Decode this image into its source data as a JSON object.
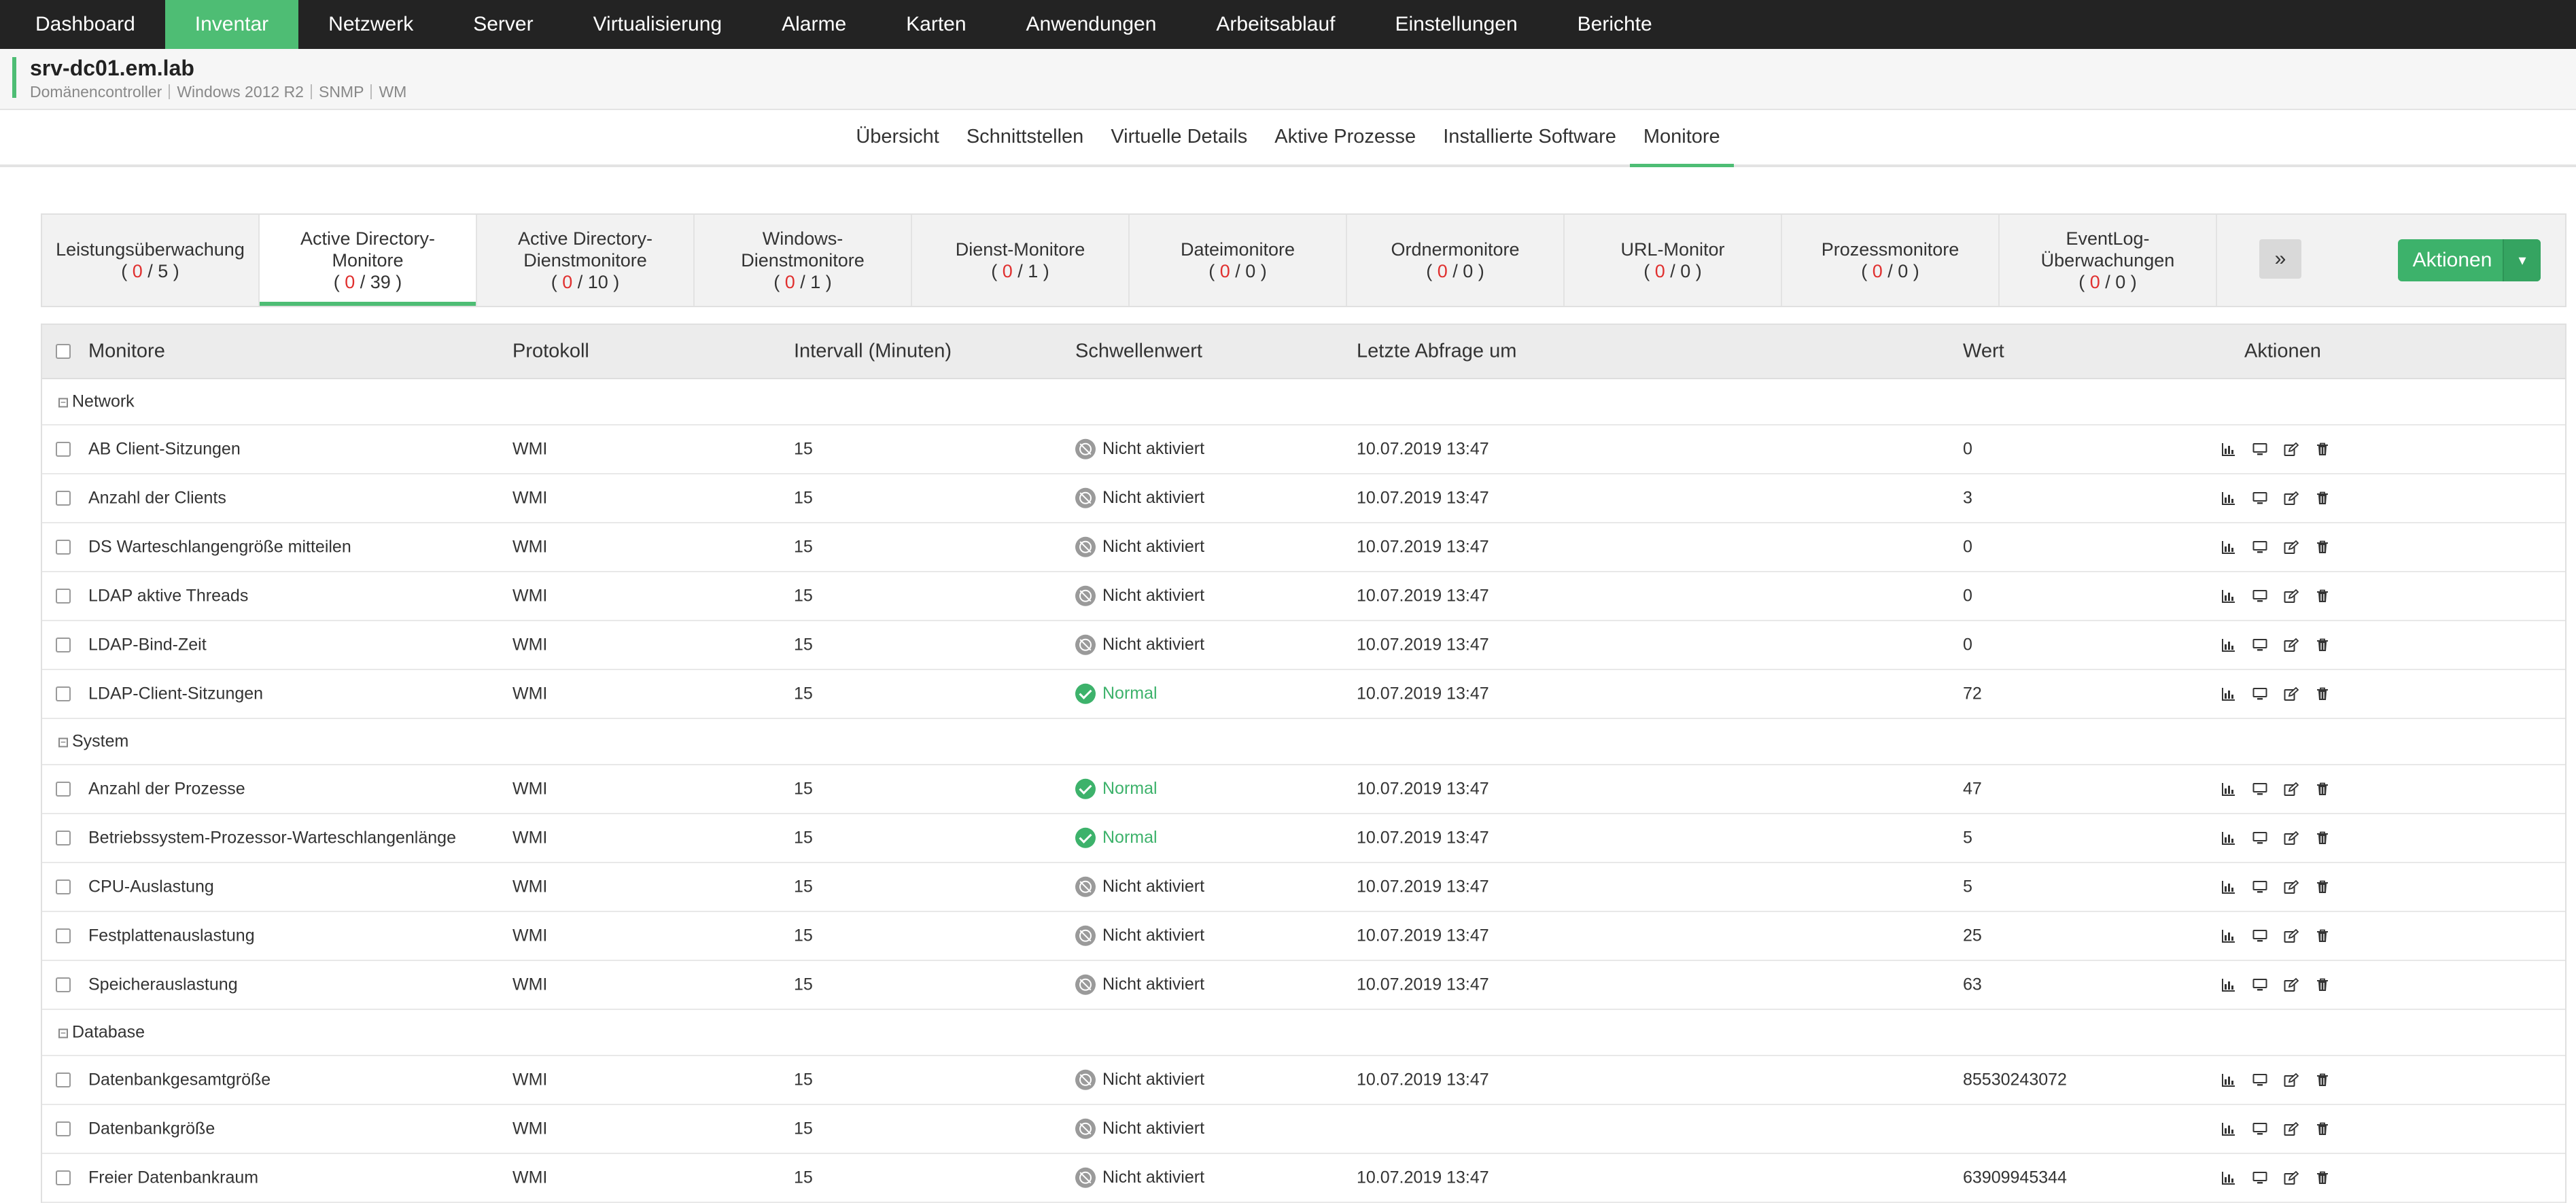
{
  "nav": {
    "items": [
      "Dashboard",
      "Inventar",
      "Netzwerk",
      "Server",
      "Virtualisierung",
      "Alarme",
      "Karten",
      "Anwendungen",
      "Arbeitsablauf",
      "Einstellungen",
      "Berichte"
    ],
    "active_index": 1
  },
  "device": {
    "name": "srv-dc01.em.lab",
    "meta": [
      "Domänencontroller",
      "Windows 2012 R2",
      "SNMP",
      "WM"
    ]
  },
  "subtabs": {
    "items": [
      "Übersicht",
      "Schnittstellen",
      "Virtuelle Details",
      "Aktive Prozesse",
      "Installierte Software",
      "Monitore"
    ],
    "active_index": 5
  },
  "categories": [
    {
      "line1": "Leistungsüberwachung",
      "line2": "",
      "a": "0",
      "b": "5"
    },
    {
      "line1": "Active Directory-",
      "line2": "Monitore",
      "a": "0",
      "b": "39"
    },
    {
      "line1": "Active Directory-",
      "line2": "Dienstmonitore",
      "a": "0",
      "b": "10"
    },
    {
      "line1": "Windows-",
      "line2": "Dienstmonitore",
      "a": "0",
      "b": "1"
    },
    {
      "line1": "Dienst-Monitore",
      "line2": "",
      "a": "0",
      "b": "1"
    },
    {
      "line1": "Dateimonitore",
      "line2": "",
      "a": "0",
      "b": "0"
    },
    {
      "line1": "Ordnermonitore",
      "line2": "",
      "a": "0",
      "b": "0"
    },
    {
      "line1": "URL-Monitor",
      "line2": "",
      "a": "0",
      "b": "0"
    },
    {
      "line1": "Prozessmonitore",
      "line2": "",
      "a": "0",
      "b": "0"
    },
    {
      "line1": "EventLog-",
      "line2": "Überwachungen",
      "a": "0",
      "b": "0"
    }
  ],
  "active_category_index": 1,
  "more_glyph": "»",
  "actions_button": {
    "label": "Aktionen",
    "caret": "▾"
  },
  "table": {
    "headers": {
      "monitor": "Monitore",
      "protocol": "Protokoll",
      "interval": "Intervall (Minuten)",
      "threshold": "Schwellenwert",
      "last_poll": "Letzte Abfrage um",
      "value": "Wert",
      "actions": "Aktionen"
    },
    "groups": [
      {
        "name": "Network",
        "rows": [
          {
            "name": "AB Client-Sitzungen",
            "protocol": "WMI",
            "interval": "15",
            "threshold": "Nicht aktiviert",
            "status": "off",
            "last": "10.07.2019 13:47",
            "value": "0"
          },
          {
            "name": "Anzahl der Clients",
            "protocol": "WMI",
            "interval": "15",
            "threshold": "Nicht aktiviert",
            "status": "off",
            "last": "10.07.2019 13:47",
            "value": "3"
          },
          {
            "name": "DS Warteschlangengröße mitteilen",
            "protocol": "WMI",
            "interval": "15",
            "threshold": "Nicht aktiviert",
            "status": "off",
            "last": "10.07.2019 13:47",
            "value": "0"
          },
          {
            "name": "LDAP aktive Threads",
            "protocol": "WMI",
            "interval": "15",
            "threshold": "Nicht aktiviert",
            "status": "off",
            "last": "10.07.2019 13:47",
            "value": "0"
          },
          {
            "name": "LDAP-Bind-Zeit",
            "protocol": "WMI",
            "interval": "15",
            "threshold": "Nicht aktiviert",
            "status": "off",
            "last": "10.07.2019 13:47",
            "value": "0"
          },
          {
            "name": "LDAP-Client-Sitzungen",
            "protocol": "WMI",
            "interval": "15",
            "threshold": "Normal",
            "status": "ok",
            "last": "10.07.2019 13:47",
            "value": "72"
          }
        ]
      },
      {
        "name": "System",
        "rows": [
          {
            "name": "Anzahl der Prozesse",
            "protocol": "WMI",
            "interval": "15",
            "threshold": "Normal",
            "status": "ok",
            "last": "10.07.2019 13:47",
            "value": "47"
          },
          {
            "name": "Betriebssystem-Prozessor-Warteschlangenlänge",
            "protocol": "WMI",
            "interval": "15",
            "threshold": "Normal",
            "status": "ok",
            "last": "10.07.2019 13:47",
            "value": "5"
          },
          {
            "name": "CPU-Auslastung",
            "protocol": "WMI",
            "interval": "15",
            "threshold": "Nicht aktiviert",
            "status": "off",
            "last": "10.07.2019 13:47",
            "value": "5"
          },
          {
            "name": "Festplattenauslastung",
            "protocol": "WMI",
            "interval": "15",
            "threshold": "Nicht aktiviert",
            "status": "off",
            "last": "10.07.2019 13:47",
            "value": "25"
          },
          {
            "name": "Speicherauslastung",
            "protocol": "WMI",
            "interval": "15",
            "threshold": "Nicht aktiviert",
            "status": "off",
            "last": "10.07.2019 13:47",
            "value": "63"
          }
        ]
      },
      {
        "name": "Database",
        "rows": [
          {
            "name": "Datenbankgesamtgröße",
            "protocol": "WMI",
            "interval": "15",
            "threshold": "Nicht aktiviert",
            "status": "off",
            "last": "10.07.2019 13:47",
            "value": "85530243072"
          },
          {
            "name": "Datenbankgröße",
            "protocol": "WMI",
            "interval": "15",
            "threshold": "Nicht aktiviert",
            "status": "off",
            "last": "",
            "value": ""
          },
          {
            "name": "Freier Datenbankraum",
            "protocol": "WMI",
            "interval": "15",
            "threshold": "Nicht aktiviert",
            "status": "off",
            "last": "10.07.2019 13:47",
            "value": "63909945344"
          }
        ]
      }
    ]
  },
  "colors": {
    "accent": "#4ebd74",
    "nav_bg": "#232323",
    "alert_red": "#e0302f",
    "status_ok": "#3db26b",
    "status_off": "#9a9a9a"
  },
  "icons": {
    "row_actions": [
      "bar-chart-icon",
      "monitor-icon",
      "edit-icon",
      "trash-icon"
    ]
  }
}
